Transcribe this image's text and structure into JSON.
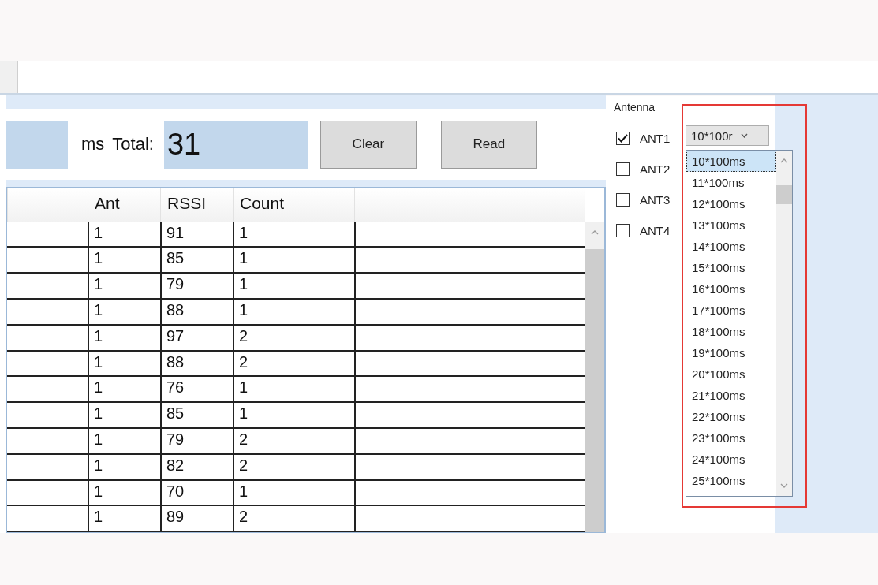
{
  "toolbar": {
    "period_field": {
      "kind": "empty"
    },
    "unit_label": "ms",
    "total_label": "Total:",
    "total_field": {
      "value": "31"
    },
    "buttons": [
      {
        "label": "Clear"
      },
      {
        "label": "Read"
      }
    ]
  },
  "table": {
    "columns": [
      "Ant",
      "RSSI",
      "Count"
    ],
    "rows": [
      {
        "ant": "1",
        "rssi": "91",
        "count": "1"
      },
      {
        "ant": "1",
        "rssi": "85",
        "count": "1"
      },
      {
        "ant": "1",
        "rssi": "79",
        "count": "1"
      },
      {
        "ant": "1",
        "rssi": "88",
        "count": "1"
      },
      {
        "ant": "1",
        "rssi": "97",
        "count": "2"
      },
      {
        "ant": "1",
        "rssi": "88",
        "count": "2"
      },
      {
        "ant": "1",
        "rssi": "76",
        "count": "1"
      },
      {
        "ant": "1",
        "rssi": "85",
        "count": "1"
      },
      {
        "ant": "1",
        "rssi": "79",
        "count": "2"
      },
      {
        "ant": "1",
        "rssi": "82",
        "count": "2"
      },
      {
        "ant": "1",
        "rssi": "70",
        "count": "1"
      },
      {
        "ant": "1",
        "rssi": "89",
        "count": "2"
      }
    ]
  },
  "antenna": {
    "title": "Antenna",
    "antennas": [
      {
        "label": "ANT1",
        "checked": true
      },
      {
        "label": "ANT2",
        "checked": false
      },
      {
        "label": "ANT3",
        "checked": false
      },
      {
        "label": "ANT4",
        "checked": false
      }
    ],
    "combo": {
      "value": "10*100r",
      "options": [
        {
          "label": "10*100ms",
          "selected": true
        },
        {
          "label": "11*100ms",
          "selected": false
        },
        {
          "label": "12*100ms",
          "selected": false
        },
        {
          "label": "13*100ms",
          "selected": false
        },
        {
          "label": "14*100ms",
          "selected": false
        },
        {
          "label": "15*100ms",
          "selected": false
        },
        {
          "label": "16*100ms",
          "selected": false
        },
        {
          "label": "17*100ms",
          "selected": false
        },
        {
          "label": "18*100ms",
          "selected": false
        },
        {
          "label": "19*100ms",
          "selected": false
        },
        {
          "label": "20*100ms",
          "selected": false
        },
        {
          "label": "21*100ms",
          "selected": false
        },
        {
          "label": "22*100ms",
          "selected": false
        },
        {
          "label": "23*100ms",
          "selected": false
        },
        {
          "label": "24*100ms",
          "selected": false
        },
        {
          "label": "25*100ms",
          "selected": false
        }
      ]
    }
  }
}
